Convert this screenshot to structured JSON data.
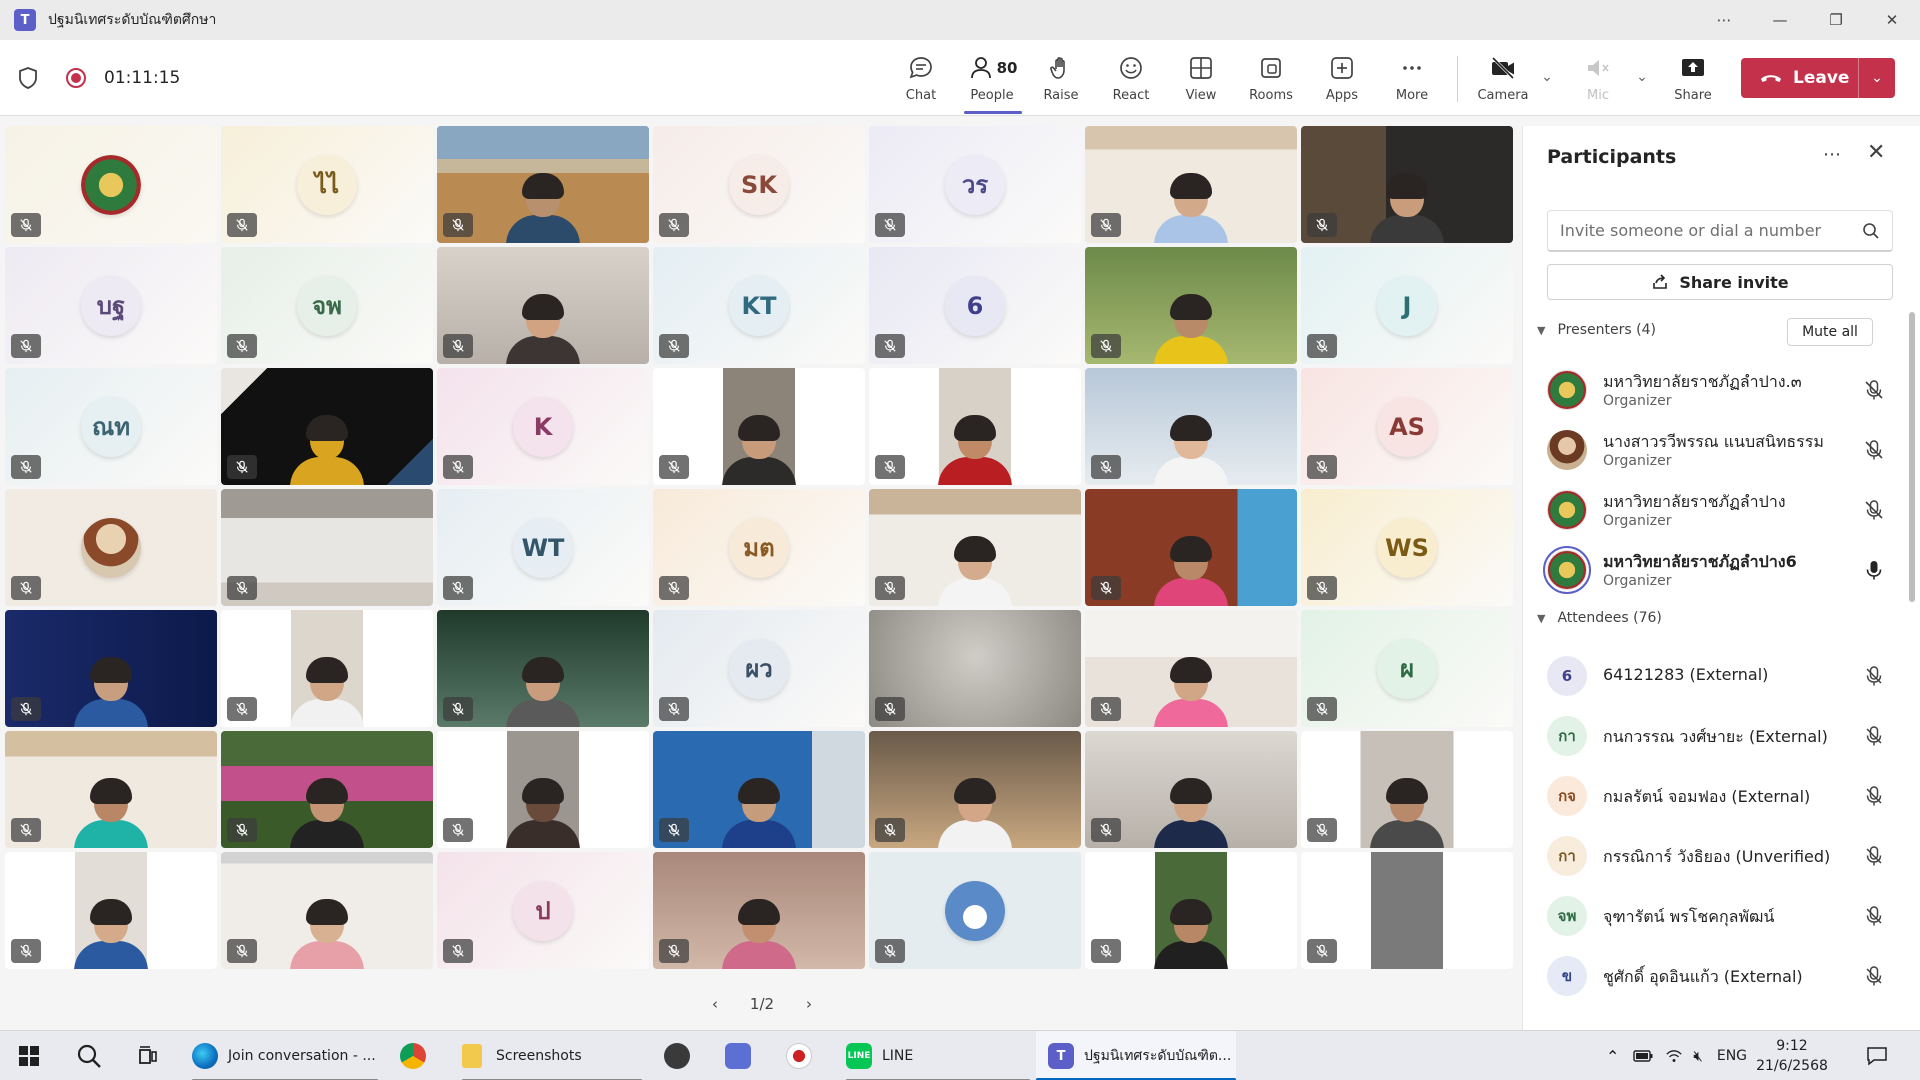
{
  "window": {
    "title": "ปฐมนิเทศระดับบัณฑิตศึกษา",
    "app_icon": "teams-icon",
    "controls": [
      "more-icon",
      "minimize-icon",
      "restore-icon",
      "close-icon"
    ]
  },
  "meeting": {
    "timer": "01:11:15"
  },
  "toolbar": {
    "chat": "Chat",
    "people": "People",
    "people_count": "80",
    "raise": "Raise",
    "react": "React",
    "view": "View",
    "rooms": "Rooms",
    "apps": "Apps",
    "more": "More",
    "camera": "Camera",
    "mic": "Mic",
    "share": "Share",
    "leave": "Leave"
  },
  "grid": {
    "tiles": [
      {
        "type": "seal"
      },
      {
        "type": "avatar",
        "initials": "ไไ",
        "bg": "#f7efd9",
        "fg": "#7a5b1e"
      },
      {
        "type": "video",
        "scene": "room"
      },
      {
        "type": "avatar",
        "initials": "SK",
        "bg": "#f6ece8",
        "fg": "#8a4a3a"
      },
      {
        "type": "avatar",
        "initials": "วร",
        "bg": "#ecebf6",
        "fg": "#4a4a8a"
      },
      {
        "type": "video",
        "scene": "woman-blue"
      },
      {
        "type": "video",
        "scene": "man-dark"
      },
      {
        "type": "avatar",
        "initials": "บฐ",
        "bg": "#eeeaf3",
        "fg": "#5a4a7a"
      },
      {
        "type": "avatar",
        "initials": "จพ",
        "bg": "#e6efe8",
        "fg": "#3a6a4a"
      },
      {
        "type": "video",
        "scene": "woman-close"
      },
      {
        "type": "avatar",
        "initials": "KT",
        "bg": "#e4eef3",
        "fg": "#2f6a80"
      },
      {
        "type": "avatar",
        "initials": "6",
        "bg": "#e8e8f4",
        "fg": "#3f3f8a"
      },
      {
        "type": "video",
        "scene": "man-yellow"
      },
      {
        "type": "avatar",
        "initials": "J",
        "bg": "#e2f1f2",
        "fg": "#2c6f74"
      },
      {
        "type": "avatar",
        "initials": "ณท",
        "bg": "#e6eff2",
        "fg": "#3b6370"
      },
      {
        "type": "video",
        "scene": "logo-dark"
      },
      {
        "type": "avatar",
        "initials": "K",
        "bg": "#f4e2ec",
        "fg": "#8a3a64"
      },
      {
        "type": "video",
        "scene": "portrait-woman"
      },
      {
        "type": "video",
        "scene": "portrait-man-red"
      },
      {
        "type": "video",
        "scene": "woman-white"
      },
      {
        "type": "avatar",
        "initials": "AS",
        "bg": "#f8e4e2",
        "fg": "#8a3a34"
      },
      {
        "type": "video",
        "scene": "photo-avatar"
      },
      {
        "type": "video",
        "scene": "empty-room"
      },
      {
        "type": "avatar",
        "initials": "WT",
        "bg": "#e6eef3",
        "fg": "#34566a"
      },
      {
        "type": "avatar",
        "initials": "มต",
        "bg": "#f8ead9",
        "fg": "#8a5a24"
      },
      {
        "type": "video",
        "scene": "woman-room"
      },
      {
        "type": "video",
        "scene": "woman-pink"
      },
      {
        "type": "avatar",
        "initials": "WS",
        "bg": "#f8edcf",
        "fg": "#7a5a14"
      },
      {
        "type": "video",
        "scene": "woman-blue-bg"
      },
      {
        "type": "video",
        "scene": "portrait-standing"
      },
      {
        "type": "video",
        "scene": "woman-window"
      },
      {
        "type": "avatar",
        "initials": "ผว",
        "bg": "#e4eaf0",
        "fg": "#3a4e64"
      },
      {
        "type": "video",
        "scene": "blur"
      },
      {
        "type": "video",
        "scene": "woman-ceiling"
      },
      {
        "type": "avatar",
        "initials": "ผ",
        "bg": "#e2f2e6",
        "fg": "#2e6a44"
      },
      {
        "type": "video",
        "scene": "man-teal"
      },
      {
        "type": "video",
        "scene": "garden"
      },
      {
        "type": "video",
        "scene": "portrait-dark"
      },
      {
        "type": "video",
        "scene": "man-blue"
      },
      {
        "type": "video",
        "scene": "woman-kitchen"
      },
      {
        "type": "video",
        "scene": "man-glasses"
      },
      {
        "type": "video",
        "scene": "portrait-man-shirt"
      },
      {
        "type": "video",
        "scene": "portrait-girl-blue"
      },
      {
        "type": "video",
        "scene": "screen-share"
      },
      {
        "type": "avatar",
        "initials": "ป",
        "bg": "#f4e2ea",
        "fg": "#8a3a5a"
      },
      {
        "type": "video",
        "scene": "woman-glasses-close"
      },
      {
        "type": "video",
        "scene": "cloud-avatar"
      },
      {
        "type": "video",
        "scene": "portrait-man-cap"
      },
      {
        "type": "video",
        "scene": "portrait-ceiling"
      }
    ],
    "pager": {
      "label": "1/2"
    }
  },
  "panel": {
    "title": "Participants",
    "search_placeholder": "Invite someone or dial a number",
    "share_invite": "Share invite",
    "presenters_header": "Presenters (4)",
    "mute_all": "Mute all",
    "attendees_header": "Attendees (76)",
    "presenters": [
      {
        "name": "มหาวิทยาลัยราชภัฏลำปาง.๓",
        "role": "Organizer",
        "avatar": "seal",
        "mic": "mic-off-icon"
      },
      {
        "name": "นางสาวรวีพรรณ แนบสนิทธรรม",
        "role": "Organizer",
        "avatar": "photo",
        "mic": "mic-off-icon"
      },
      {
        "name": "มหาวิทยาลัยราชภัฏลำปาง",
        "role": "Organizer",
        "avatar": "seal",
        "mic": "mic-off-icon"
      },
      {
        "name": "มหาวิทยาลัยราชภัฏลำปาง6",
        "role": "Organizer",
        "avatar": "seal",
        "mic": "mic-on-icon",
        "bold": true
      }
    ],
    "attendees": [
      {
        "initials": "6",
        "name": "64121283 (External)",
        "bg": "#e8e8f4",
        "fg": "#3f3f8a"
      },
      {
        "initials": "กา",
        "name": "กนกวรรณ วงศ์ษายะ (External)",
        "bg": "#e2f2e6",
        "fg": "#2e6a44"
      },
      {
        "initials": "กจ",
        "name": "กมลรัตน์ จอมฟอง (External)",
        "bg": "#fbe9dc",
        "fg": "#8a4a1e"
      },
      {
        "initials": "กา",
        "name": "กรรณิการ์ วังธิยอง (Unverified)",
        "bg": "#f8ecdc",
        "fg": "#7a5a24"
      },
      {
        "initials": "จพ",
        "name": "จุฑารัตน์ พรโชคกุลพัฒน์",
        "bg": "#e2f2e6",
        "fg": "#2e6a44"
      },
      {
        "initials": "ข",
        "name": "ชูศักดิ์ อุดอินแก้ว (External)",
        "bg": "#e6eaf6",
        "fg": "#34468a"
      }
    ]
  },
  "taskbar": {
    "items": [
      {
        "label": "Join conversation - ..."
      },
      {
        "label": "Screenshots"
      },
      {
        "label": "LINE"
      },
      {
        "label": "ปฐมนิเทศระดับบัณฑิต..."
      }
    ],
    "lang": "ENG",
    "time": "9:12",
    "date": "21/6/2568"
  },
  "colors": {
    "accent": "#5b5fc7",
    "leave": "#c4314b",
    "taskbar_accent": "#0067c0"
  }
}
